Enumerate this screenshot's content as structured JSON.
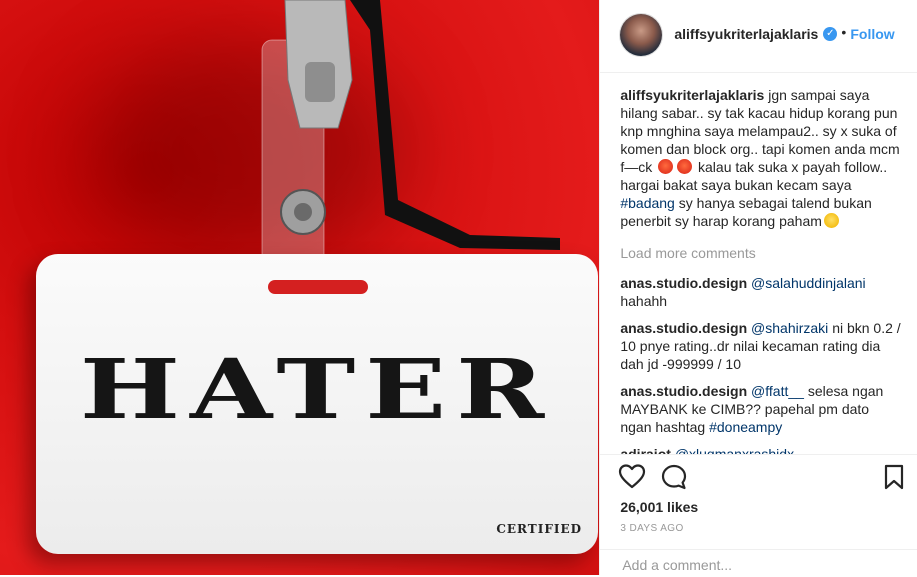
{
  "post": {
    "username": "aliffsyukriterlajaklaris",
    "verified_icon": "verified-badge-icon",
    "separator": "•",
    "follow_label": "Follow"
  },
  "photo": {
    "badge_text": "HATER",
    "certified_text": "CERTIFIED",
    "background_color": "#e41b1b"
  },
  "caption": {
    "author": "aliffsyukriterlajaklaris",
    "part1": "jgn sampai saya hilang sabar.. sy tak kacau hidup korang pun knp mnghina saya melampau2.. sy x suka of komen dan block org.. tapi komen anda mcm f—ck",
    "part2": "kalau tak suka x payah follow.. hargai bakat saya bukan kecam saya",
    "hashtag": "#badang",
    "part3": "sy hanya sebagai talend bukan penerbit sy harap korang paham"
  },
  "load_more": "Load more comments",
  "comments": [
    {
      "author": "anas.studio.design",
      "mention": "@salahuddinjalani",
      "text": "hahahh"
    },
    {
      "author": "anas.studio.design",
      "mention": "@shahirzaki",
      "text": "ni bkn 0.2 / 10 pnye rating..dr nilai kecaman rating dia dah jd -999999 / 10"
    },
    {
      "author": "anas.studio.design",
      "mention": "@ffatt__",
      "text": "selesa ngan MAYBANK ke CIMB?? papehal pm dato ngan hashtag",
      "hashtag": "#doneampy"
    },
    {
      "author": "adiraiot",
      "mention": "@xluqmanxrashidx",
      "text": ""
    }
  ],
  "actions": {
    "like_icon": "heart-icon",
    "comment_icon": "comment-bubble-icon",
    "save_icon": "bookmark-icon",
    "likes": "26,001 likes",
    "timestamp": "3 DAYS AGO",
    "add_comment_placeholder": "Add a comment..."
  },
  "colors": {
    "accent": "#3897f0",
    "link": "#003569",
    "muted": "#999999",
    "text": "#262626"
  }
}
